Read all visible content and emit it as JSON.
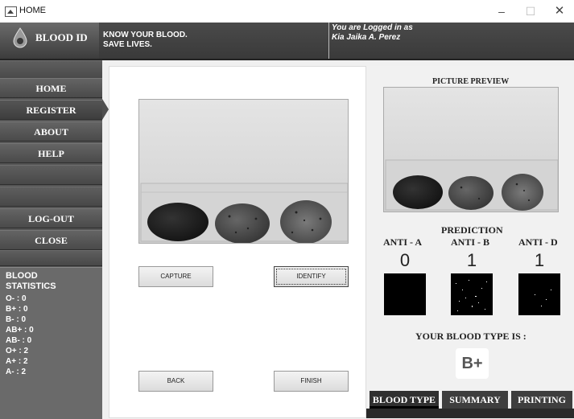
{
  "window": {
    "title": "HOME",
    "minimize": "–",
    "maximize": "☐",
    "close": "✕"
  },
  "header": {
    "app_name": "BLOOD ID",
    "slogan_line1": "KNOW YOUR BLOOD.",
    "slogan_line2": "SAVE LIVES.",
    "logged_line1": "You are Logged in as",
    "logged_user": "Kia Jaika A. Perez"
  },
  "sidebar": {
    "items": [
      {
        "label": "HOME"
      },
      {
        "label": "REGISTER"
      },
      {
        "label": "ABOUT"
      },
      {
        "label": "HELP"
      },
      {
        "label": "LOG-OUT"
      },
      {
        "label": "CLOSE"
      }
    ],
    "active": "REGISTER"
  },
  "stats": {
    "title": "BLOOD STATISTICS",
    "lines": [
      "O- : 0",
      "B+ : 0",
      "B- : 0",
      "AB+ : 0",
      "AB- : 0",
      "O+ : 2",
      "A+ : 2",
      "A- : 2"
    ]
  },
  "buttons": {
    "capture": "CAPTURE",
    "identify": "IDENTIFY",
    "back": "BACK",
    "finish": "FINISH"
  },
  "preview": {
    "label": "PICTURE PREVIEW"
  },
  "prediction": {
    "title": "PREDICTION",
    "anti_a": {
      "label": "ANTI - A",
      "value": "0"
    },
    "anti_b": {
      "label": "ANTI - B",
      "value": "1"
    },
    "anti_d": {
      "label": "ANTI - D",
      "value": "1"
    }
  },
  "result": {
    "label": "YOUR BLOOD TYPE IS :",
    "value": "B+"
  },
  "tabs": [
    {
      "label": "BLOOD TYPE"
    },
    {
      "label": "SUMMARY"
    },
    {
      "label": "PRINTING"
    }
  ],
  "colors": {
    "sidebar": "#555555",
    "header": "#3f3f3f",
    "tab_bg": "#3e3e3e"
  }
}
